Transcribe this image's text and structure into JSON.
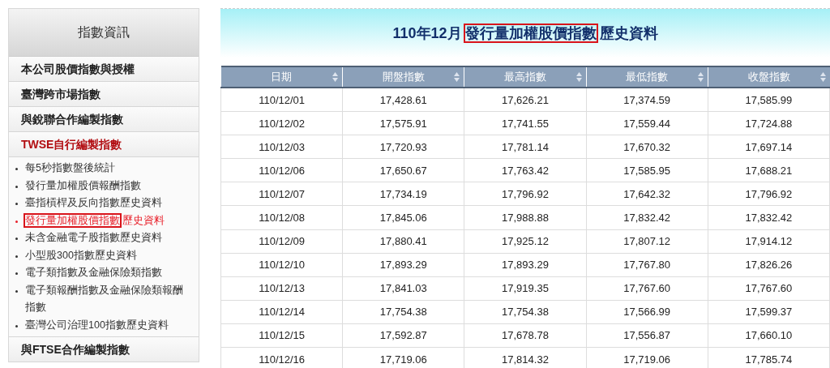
{
  "sidebar": {
    "title": "指數資訊",
    "items": [
      {
        "label": "本公司股價指數與授權",
        "selected": false
      },
      {
        "label": "臺灣跨市場指數",
        "selected": false
      },
      {
        "label": "與銳聯合作編製指數",
        "selected": false
      },
      {
        "label": "TWSE自行編製指數",
        "selected": true,
        "children": [
          {
            "parts": [
              "每5秒指數盤後統計"
            ],
            "selected": false
          },
          {
            "parts": [
              "發行量加權股價報酬指數"
            ],
            "selected": false
          },
          {
            "parts": [
              "臺指槓桿及反向指數歷史資料"
            ],
            "selected": false
          },
          {
            "parts": [
              "發行量加權股價指數",
              "歷史資料"
            ],
            "selected": true
          },
          {
            "parts": [
              "未含金融電子股指數歷史資料"
            ],
            "selected": false
          },
          {
            "parts": [
              "小型股300指數歷史資料"
            ],
            "selected": false
          },
          {
            "parts": [
              "電子類指數及金融保險類指數"
            ],
            "selected": false
          },
          {
            "parts": [
              "電子類報酬指數及金融保險類報酬指數"
            ],
            "selected": false
          },
          {
            "parts": [
              "臺灣公司治理100指數歷史資料"
            ],
            "selected": false
          }
        ]
      },
      {
        "label": "與FTSE合作編製指數",
        "selected": false
      }
    ]
  },
  "page_title": {
    "before": "110年12月",
    "highlight": "發行量加權股價指數",
    "after": "歷史資料"
  },
  "table": {
    "columns": [
      "日期",
      "開盤指數",
      "最高指數",
      "最低指數",
      "收盤指數"
    ],
    "rows": [
      [
        "110/12/01",
        "17,428.61",
        "17,626.21",
        "17,374.59",
        "17,585.99"
      ],
      [
        "110/12/02",
        "17,575.91",
        "17,741.55",
        "17,559.44",
        "17,724.88"
      ],
      [
        "110/12/03",
        "17,720.93",
        "17,781.14",
        "17,670.32",
        "17,697.14"
      ],
      [
        "110/12/06",
        "17,650.67",
        "17,763.42",
        "17,585.95",
        "17,688.21"
      ],
      [
        "110/12/07",
        "17,734.19",
        "17,796.92",
        "17,642.32",
        "17,796.92"
      ],
      [
        "110/12/08",
        "17,845.06",
        "17,988.88",
        "17,832.42",
        "17,832.42"
      ],
      [
        "110/12/09",
        "17,880.41",
        "17,925.12",
        "17,807.12",
        "17,914.12"
      ],
      [
        "110/12/10",
        "17,893.29",
        "17,893.29",
        "17,767.80",
        "17,826.26"
      ],
      [
        "110/12/13",
        "17,841.03",
        "17,919.35",
        "17,767.60",
        "17,767.60"
      ],
      [
        "110/12/14",
        "17,754.38",
        "17,754.38",
        "17,566.99",
        "17,599.37"
      ],
      [
        "110/12/15",
        "17,592.87",
        "17,678.78",
        "17,556.87",
        "17,660.10"
      ],
      [
        "110/12/16",
        "17,719.06",
        "17,814.32",
        "17,719.06",
        "17,785.74"
      ]
    ]
  }
}
